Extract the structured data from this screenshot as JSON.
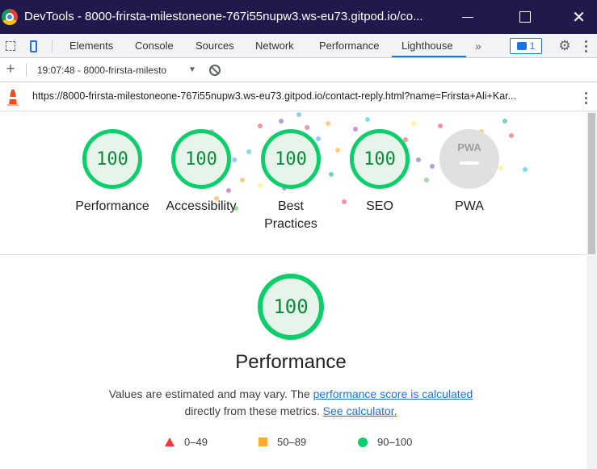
{
  "window": {
    "title": "DevTools - 8000-frirsta-milestoneone-767i55nupw3.ws-eu73.gitpod.io/co...",
    "minimize_label": "",
    "maximize_label": "",
    "close_label": "✕"
  },
  "devtools_tabs": [
    {
      "label": "Elements"
    },
    {
      "label": "Console"
    },
    {
      "label": "Sources"
    },
    {
      "label": "Network"
    },
    {
      "label": "Performance"
    },
    {
      "label": "Lighthouse",
      "active": true
    }
  ],
  "more_tabs_label": "»",
  "issues_count": "1",
  "lighthouse_toolbar": {
    "report_label": "19:07:48 - 8000-frirsta-milesto",
    "caret": "▼"
  },
  "report_url": "https://8000-frirsta-milestoneone-767i55nupw3.ws-eu73.gitpod.io/contact-reply.html?name=Frirsta+Ali+Kar...",
  "categories": [
    {
      "label": "Performance",
      "score": "100"
    },
    {
      "label": "Accessibility",
      "score": "100"
    },
    {
      "label": "Best Practices",
      "score": "100"
    },
    {
      "label": "SEO",
      "score": "100"
    },
    {
      "label": "PWA",
      "score": "PWA"
    }
  ],
  "performance_section": {
    "score": "100",
    "title": "Performance",
    "desc_prefix": "Values are estimated and may vary. The ",
    "link1": "performance score is calculated",
    "desc_mid": "directly from these metrics. ",
    "link2": "See calculator."
  },
  "legend": [
    {
      "range": "0–49",
      "color": "#ff3333",
      "icon": "triangle-icon"
    },
    {
      "range": "50–89",
      "color": "#ffaa33",
      "icon": "square-icon"
    },
    {
      "range": "90–100",
      "color": "#0cce6b",
      "icon": "circle-icon"
    }
  ],
  "colors": {
    "pass": "#0cce6b",
    "pass_text": "#0a8a3e",
    "link": "#1a73e8",
    "titlebar": "#1f1a4b"
  }
}
